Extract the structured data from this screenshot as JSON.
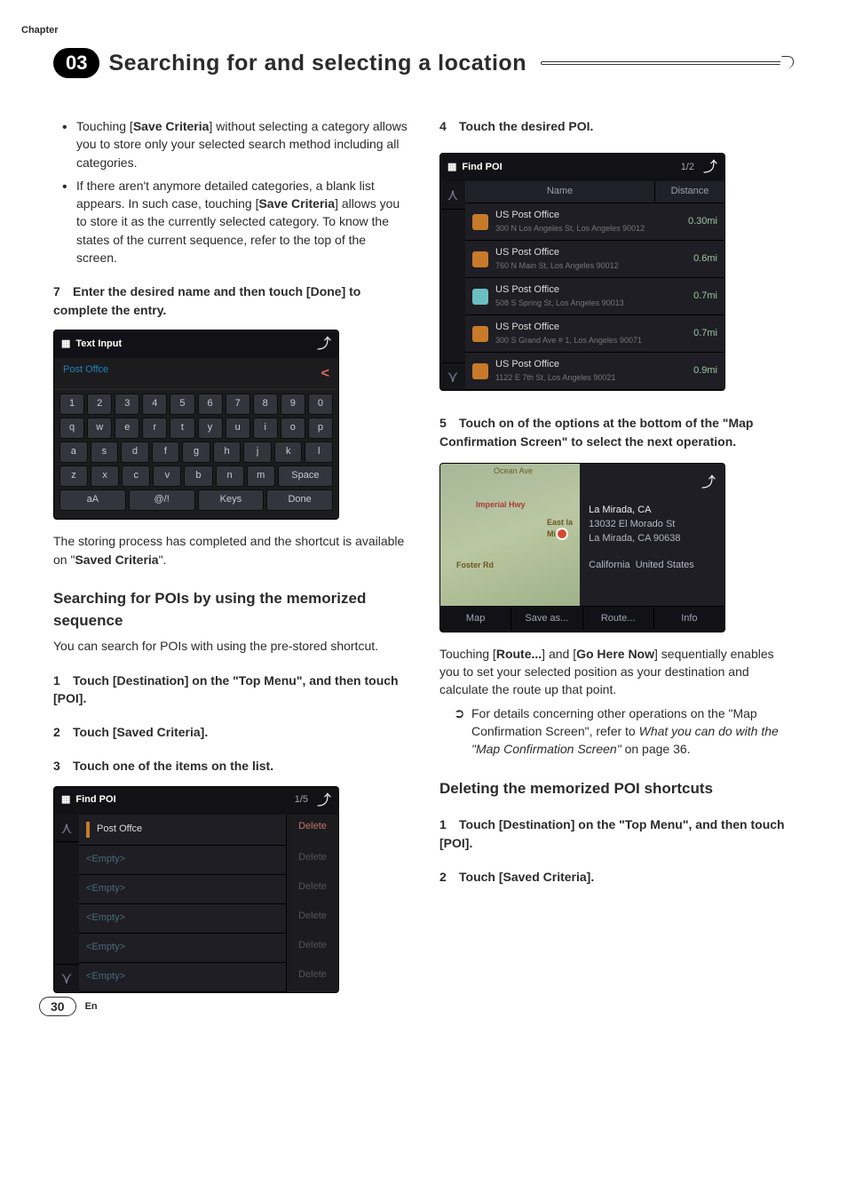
{
  "chapterLabel": "Chapter",
  "chapterNum": "03",
  "pageTitle": "Searching for and selecting a location",
  "left": {
    "bullets": [
      {
        "text_a": "Touching [",
        "bold": "Save Criteria",
        "text_b": "] without selecting a category allows you to store only your selected search method including all categories."
      },
      {
        "text_a": "If there aren't anymore detailed categories, a blank list appears. In such case, touching [",
        "bold": "Save Criteria",
        "text_b": "] allows you to store it as the currently selected category. To know the states of the current sequence, refer to the top of the screen."
      }
    ],
    "step7": {
      "num": "7",
      "text": "Enter the desired name and then touch [Done] to complete the entry."
    },
    "textInput": {
      "title": "Text Input",
      "field": "Post Offce",
      "row1": [
        "1",
        "2",
        "3",
        "4",
        "5",
        "6",
        "7",
        "8",
        "9",
        "0"
      ],
      "row2": [
        "q",
        "w",
        "e",
        "r",
        "t",
        "y",
        "u",
        "i",
        "o",
        "p"
      ],
      "row3": [
        "a",
        "s",
        "d",
        "f",
        "g",
        "h",
        "j",
        "k",
        "l"
      ],
      "row4": [
        "z",
        "x",
        "c",
        "v",
        "b",
        "n",
        "m",
        "Space"
      ],
      "row5": [
        "aA",
        "@/!",
        "Keys",
        "Done"
      ]
    },
    "afterKb_a": "The storing process has completed and the shortcut is available on \"",
    "afterKb_bold": "Saved Criteria",
    "afterKb_b": "\".",
    "subhead1": "Searching for POIs by using the memorized sequence",
    "paraSub1": "You can search for POIs with using the pre-stored shortcut.",
    "step1": {
      "num": "1",
      "text": "Touch [Destination] on the \"Top Menu\", and then touch [POI]."
    },
    "step2": {
      "num": "2",
      "text": "Touch [Saved Criteria]."
    },
    "step3": {
      "num": "3",
      "text": "Touch one of the items on the list."
    },
    "findPoiList": {
      "title": "Find POI",
      "page": "1/5",
      "rows": [
        {
          "name": "Post Offce",
          "del": "Delete",
          "active": true
        },
        {
          "name": "<Empty>",
          "del": "Delete",
          "active": false
        },
        {
          "name": "<Empty>",
          "del": "Delete",
          "active": false
        },
        {
          "name": "<Empty>",
          "del": "Delete",
          "active": false
        },
        {
          "name": "<Empty>",
          "del": "Delete",
          "active": false
        },
        {
          "name": "<Empty>",
          "del": "Delete",
          "active": false
        }
      ]
    }
  },
  "right": {
    "step4": {
      "num": "4",
      "text": "Touch the desired POI."
    },
    "poiResults": {
      "title": "Find POI",
      "page": "1/2",
      "headers": {
        "name": "Name",
        "dist": "Distance"
      },
      "rows": [
        {
          "t1": "US Post Office",
          "t2": "300 N Los Angeles St, Los Angeles 90012",
          "dist": "0.30mi"
        },
        {
          "t1": "US Post Office",
          "t2": "760 N Main St, Los Angeles 90012",
          "dist": "0.6mi"
        },
        {
          "t1": "US Post Office",
          "t2": "508 S Spring St, Los Angeles 90013",
          "dist": "0.7mi"
        },
        {
          "t1": "US Post Office",
          "t2": "300 S Grand Ave # 1, Los Angeles 90071",
          "dist": "0.7mi"
        },
        {
          "t1": "US Post Office",
          "t2": "1122 E 7th St, Los Angeles 90021",
          "dist": "0.9mi"
        }
      ]
    },
    "step5": {
      "num": "5",
      "text": "Touch on of the options at the bottom of the \"Map Confirmation Screen\" to select the next operation."
    },
    "mapConfirm": {
      "city": "La Mirada, CA",
      "addr1": "13032 El Morado St",
      "addr2": "La Mirada, CA 90638",
      "region": "California",
      "country": "United States",
      "mapLabels": {
        "top": "Ocean Ave",
        "r1": "Imperial Hwy",
        "r2": "East la Mir",
        "r3": "Foster Rd"
      },
      "buttons": [
        "Map",
        "Save as...",
        "Route...",
        "Info"
      ]
    },
    "afterMap_a": "Touching [",
    "afterMap_b1": "Route...",
    "afterMap_c": "] and [",
    "afterMap_b2": "Go Here Now",
    "afterMap_d": "] sequentially enables you to set your selected position as your destination and calculate the route up that point.",
    "ref": {
      "lead": "For details concerning other operations on the \"Map Confirmation Screen\", refer to ",
      "ital": "What you can do with the \"Map Confirmation Screen\"",
      "tail": " on page 36."
    },
    "subhead2": "Deleting the memorized POI shortcuts",
    "r_step1": {
      "num": "1",
      "text": "Touch [Destination] on the \"Top Menu\", and then touch [POI]."
    },
    "r_step2": {
      "num": "2",
      "text": "Touch [Saved Criteria]."
    }
  },
  "pageNum": "30",
  "langLabel": "En"
}
